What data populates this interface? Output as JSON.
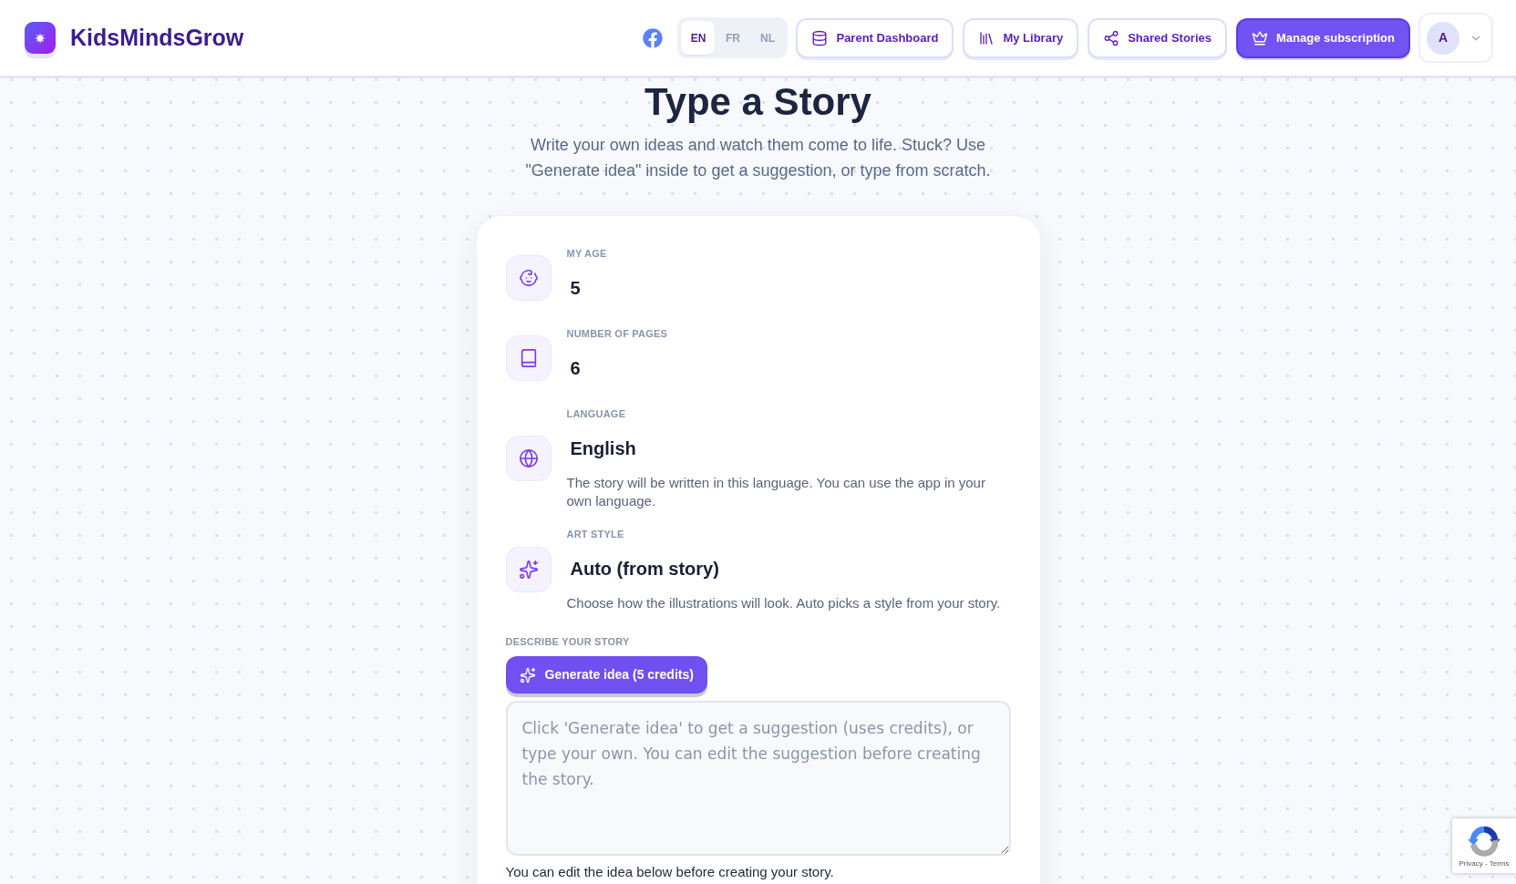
{
  "header": {
    "logo": {
      "text": "KidsMindsGrow"
    },
    "language_switch": [
      {
        "label": "EN",
        "selected": true
      },
      {
        "label": "FR",
        "selected": false
      },
      {
        "label": "NL",
        "selected": false
      }
    ],
    "nav_buttons": [
      {
        "label": "Parent Dashboard",
        "kind": "outline"
      },
      {
        "label": "My Library",
        "kind": "outline"
      },
      {
        "label": "Shared Stories",
        "kind": "outline"
      },
      {
        "label": "Manage subscription",
        "kind": "primary"
      }
    ],
    "user_menu": {
      "initial": "A"
    }
  },
  "page": {
    "title": "Type a Story",
    "subtitle": "Write your own ideas and watch them come to life. Stuck? Use \"Generate idea\" inside to get a suggestion, or type from scratch."
  },
  "form": {
    "fields": [
      {
        "label": "MY AGE",
        "value": "5"
      },
      {
        "label": "NUMBER OF PAGES",
        "value": "6"
      },
      {
        "label": "LANGUAGE",
        "value": "English",
        "hint": "The story will be written in this language. You can use the app in your own language."
      },
      {
        "label": "ART STYLE",
        "value": "Auto (from story)",
        "hint": "Choose how the illustrations will look. Auto picks a style from your story."
      }
    ],
    "description": {
      "label": "DESCRIBE YOUR STORY",
      "generate_button": "Generate idea (5 credits)",
      "placeholder": "Click 'Generate idea' to get a suggestion (uses credits), or type your own. You can edit the suggestion before creating the story.",
      "note": "You can edit the idea below before creating your story."
    }
  },
  "captcha_badge": {
    "links": "Privacy - Terms"
  }
}
